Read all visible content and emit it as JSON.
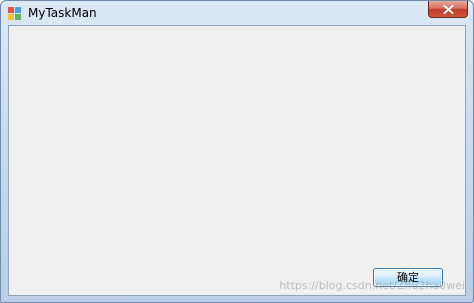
{
  "window": {
    "title": "MyTaskMan",
    "app_icon": "application-icon",
    "close_icon": "close-icon"
  },
  "dialog": {
    "ok_label": "确定"
  },
  "watermark": {
    "text": "https://blog.csdn.net/Zhu2ha0wei"
  },
  "colors": {
    "client_background": "#f0f0f0",
    "close_button": "#c0392b",
    "button_border": "#3c7fb1"
  }
}
